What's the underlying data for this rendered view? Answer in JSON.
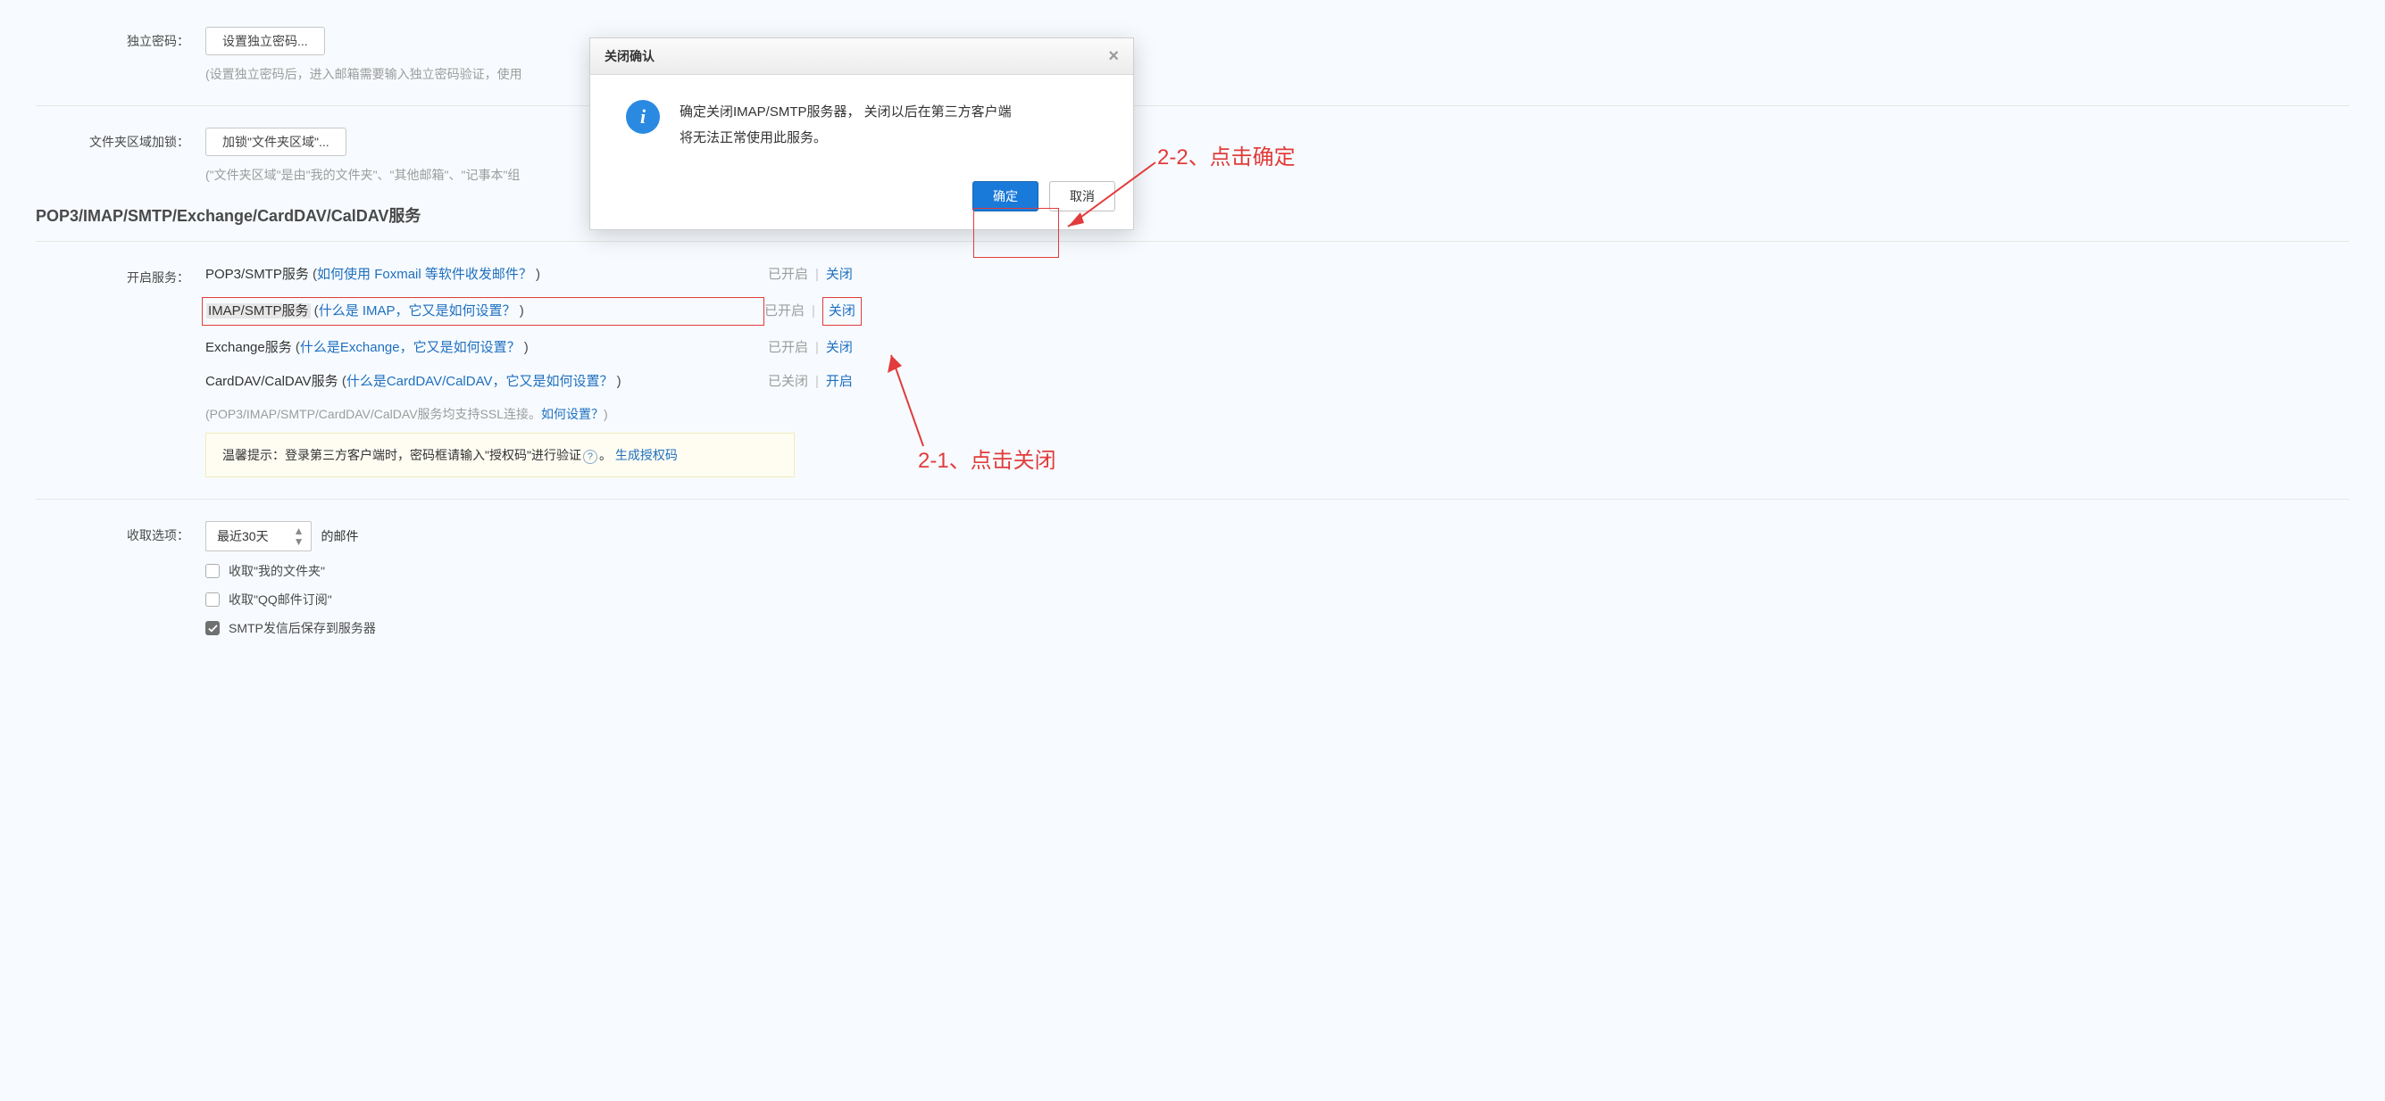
{
  "pwd": {
    "label": "独立密码：",
    "button": "设置独立密码...",
    "hint": "(设置独立密码后，进入邮箱需要输入独立密码验证，使用"
  },
  "lock": {
    "label": "文件夹区域加锁：",
    "button": "加锁\"文件夹区域\"...",
    "hint": "(\"文件夹区域\"是由\"我的文件夹\"、\"其他邮箱\"、\"记事本\"组"
  },
  "section_title": "POP3/IMAP/SMTP/Exchange/CardDAV/CalDAV服务",
  "svc_label": "开启服务：",
  "services": [
    {
      "name": "POP3/SMTP服务",
      "help": "如何使用 Foxmail 等软件收发邮件？",
      "status": "已开启",
      "action": "关闭"
    },
    {
      "name": "IMAP/SMTP服务",
      "help": "什么是 IMAP，它又是如何设置？",
      "status": "已开启",
      "action": "关闭"
    },
    {
      "name": "Exchange服务",
      "help": "什么是Exchange，它又是如何设置？",
      "status": "已开启",
      "action": "关闭"
    },
    {
      "name": "CardDAV/CalDAV服务",
      "help": "什么是CardDAV/CalDAV，它又是如何设置？",
      "status": "已关闭",
      "action": "开启"
    }
  ],
  "ssl_hint_pre": "(POP3/IMAP/SMTP/CardDAV/CalDAV服务均支持SSL连接。",
  "ssl_hint_link": "如何设置？",
  "ssl_hint_post": ")",
  "tipbox": {
    "prefix": "温馨提示：登录第三方客户端时，密码框请输入\"授权码\"进行验证",
    "link": "生成授权码"
  },
  "recv": {
    "label": "收取选项：",
    "select": "最近30天",
    "suffix": "的邮件",
    "cb1": "收取\"我的文件夹\"",
    "cb2": "收取\"QQ邮件订阅\"",
    "cb3": "SMTP发信后保存到服务器"
  },
  "modal": {
    "title": "关闭确认",
    "msg1": "确定关闭IMAP/SMTP服务器， 关闭以后在第三方客户端",
    "msg2": "将无法正常使用此服务。",
    "confirm": "确定",
    "cancel": "取消"
  },
  "anno": {
    "a1": "2-1、点击关闭",
    "a2": "2-2、点击确定"
  }
}
